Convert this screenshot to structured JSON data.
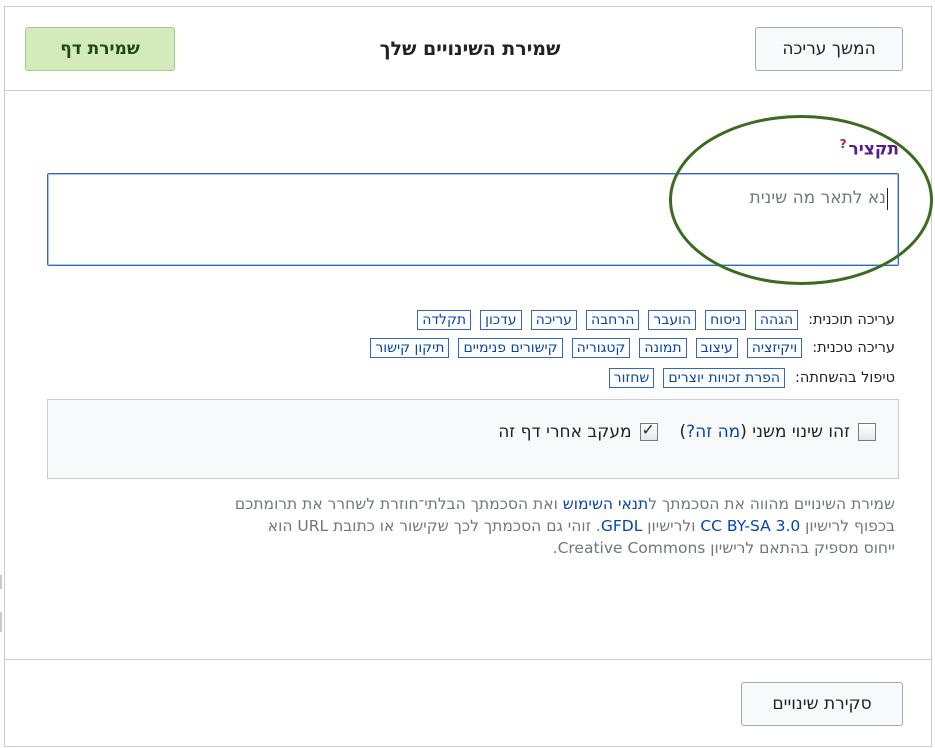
{
  "header": {
    "continue_label": "המשך עריכה",
    "title": "שמירת השינויים שלך",
    "save_label": "שמירת דף"
  },
  "summary": {
    "label": "תקציר",
    "help_mark": "?",
    "placeholder": "נא לתאר מה שינית",
    "value": ""
  },
  "tag_rows": {
    "content": {
      "label": "עריכה תוכנית:",
      "tags": [
        "הגהה",
        "ניסוח",
        "הועבר",
        "הרחבה",
        "עריכה",
        "עדכון",
        "תקלדה"
      ]
    },
    "technical": {
      "label": "עריכה טכנית:",
      "tags": [
        "ויקיזציה",
        "עיצוב",
        "תמונה",
        "קטגוריה",
        "קישורים פנימיים",
        "תיקון קישור"
      ]
    },
    "vandalism": {
      "label": "טיפול בהשחתה:",
      "tags": [
        "הפרת זכויות יוצרים",
        "שחזור"
      ]
    }
  },
  "options": {
    "minor_label_before": "זהו שינוי משני (",
    "minor_link": "מה זה?",
    "minor_label_after": ")",
    "minor_checked": false,
    "watch_label": "מעקב אחרי דף זה",
    "watch_checked": true
  },
  "legal": {
    "line1_a": "שמירת השינויים מהווה את הסכמתך ל",
    "terms_link": "תנאי השימוש",
    "line1_b": " ואת הסכמתך הבלתי־חוזרת לשחרר את תרומתכם",
    "line2_a": "בכפוף לרישיון ",
    "cc_link": "CC BY-SA 3.0",
    "line2_b": " ולרישיון ",
    "gfdl_link": "GFDL",
    "line2_c": ". זוהי גם הסכמתך לכך שקישור או כתובת URL הוא",
    "line3": "ייחוס מספיק בהתאם לרישיון Creative Commons."
  },
  "footer": {
    "review_label": "סקירת שינויים"
  },
  "colors": {
    "save_bg": "#d3ebbb",
    "link": "#0645ad",
    "focus_border": "#36c",
    "annotation_circle": "#3a6b1f"
  }
}
